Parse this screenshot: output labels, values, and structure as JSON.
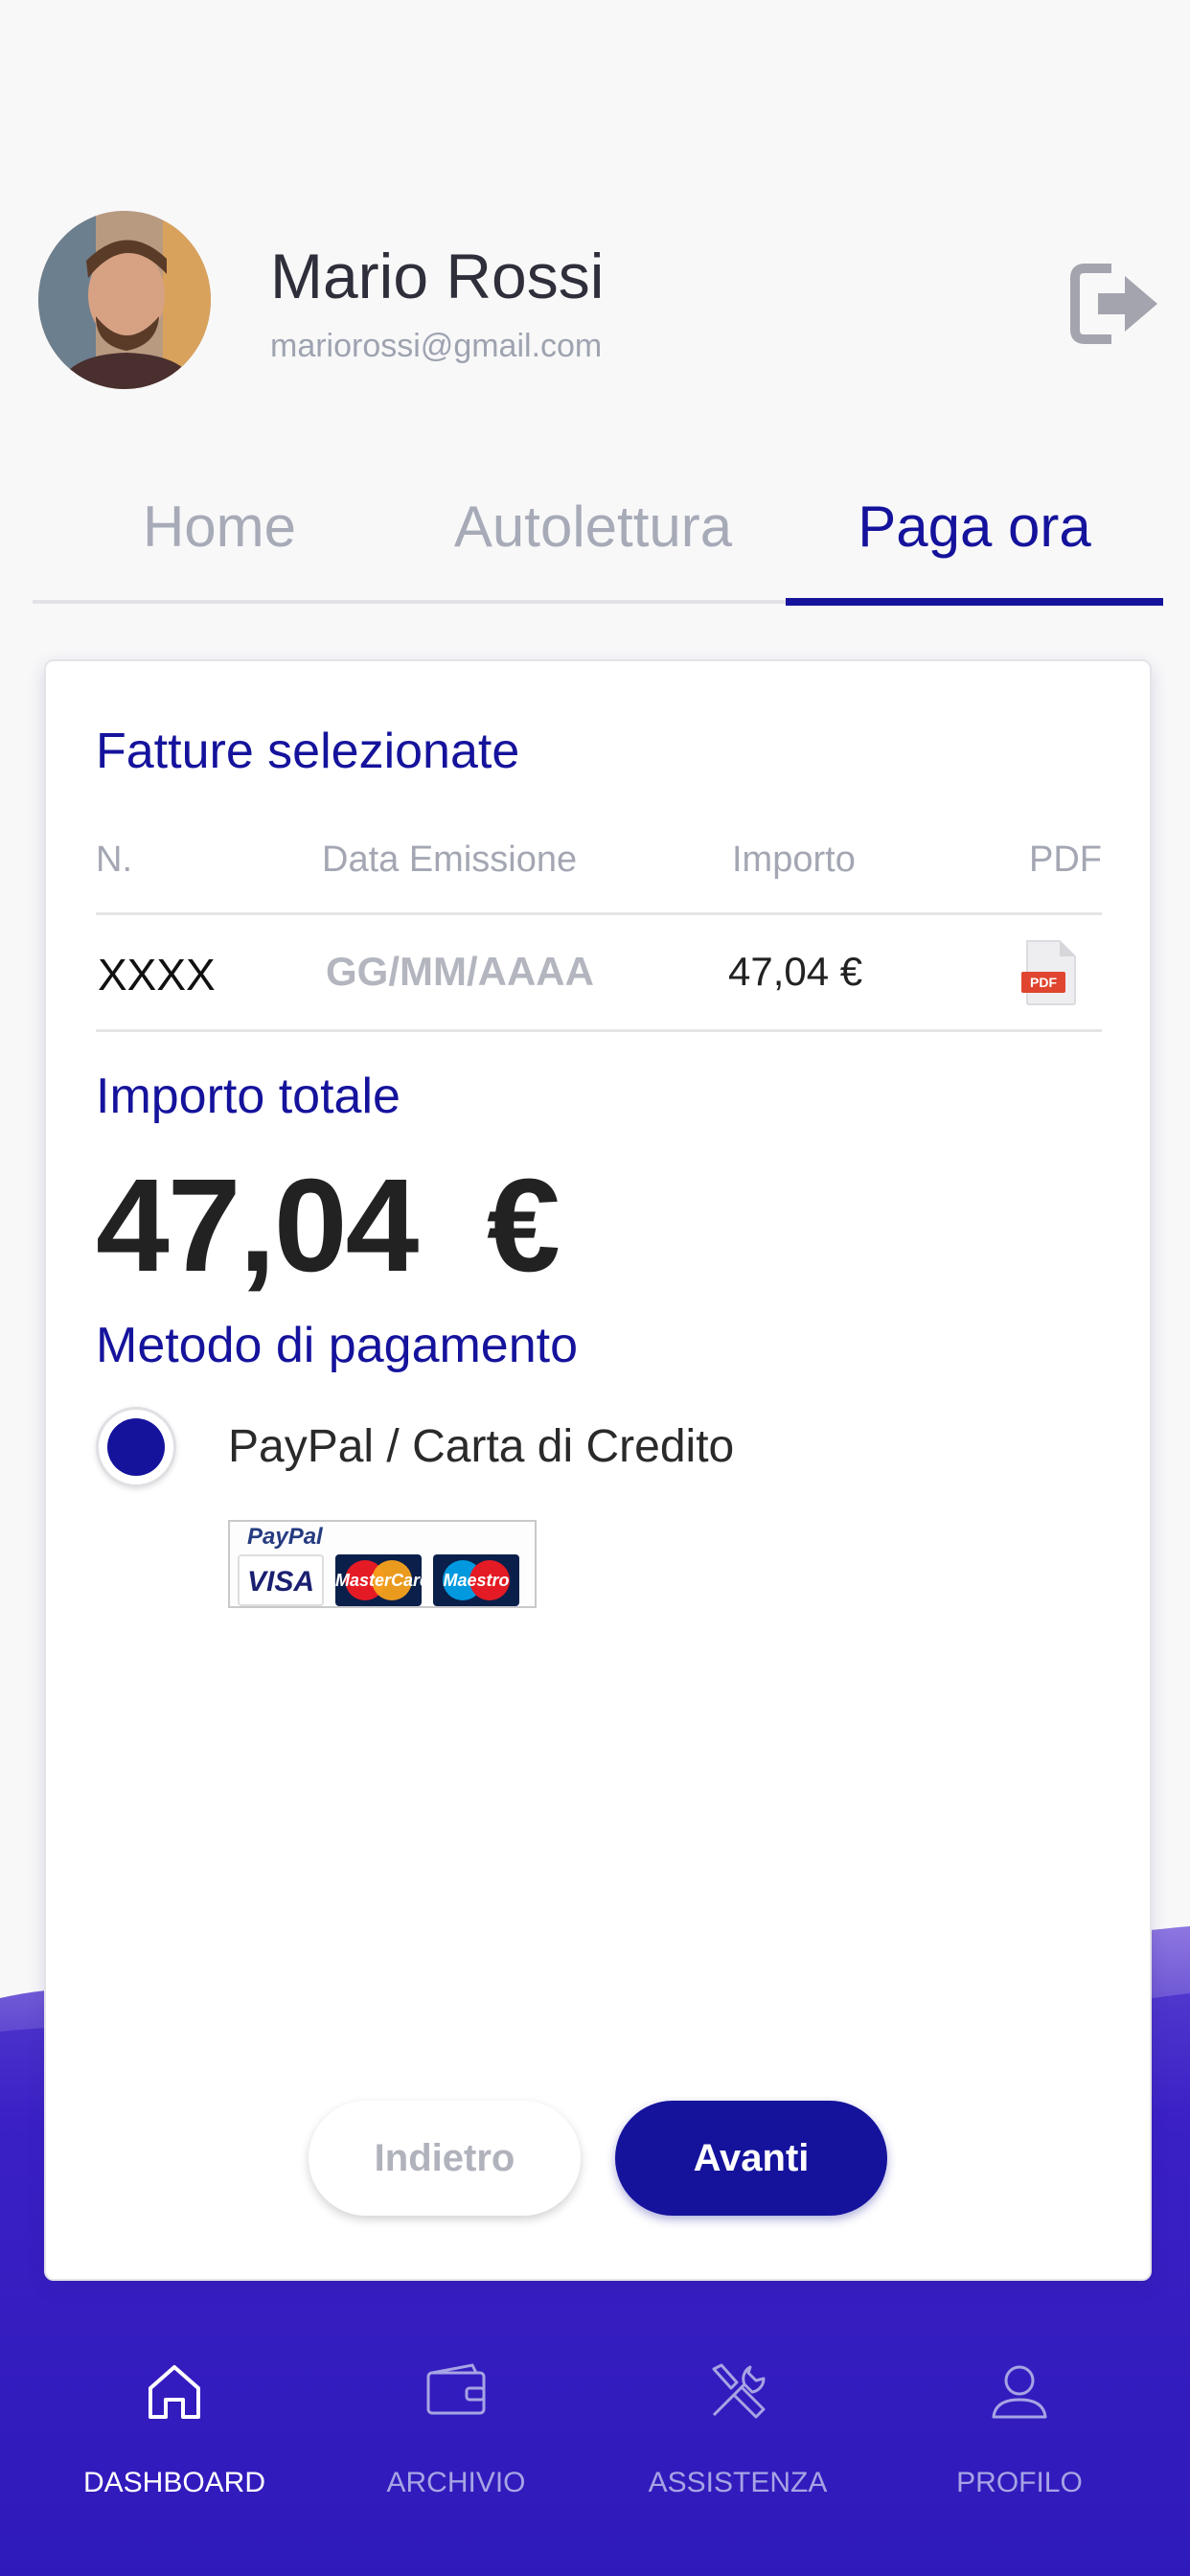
{
  "header": {
    "user_name": "Mario Rossi",
    "user_email": "mariorossi@gmail.com",
    "logout_icon": "logout-icon"
  },
  "tabs": [
    {
      "label": "Home",
      "active": false
    },
    {
      "label": "Autolettura",
      "active": false
    },
    {
      "label": "Paga ora",
      "active": true
    }
  ],
  "invoices": {
    "title": "Fatture selezionate",
    "columns": [
      "N.",
      "Data Emissione",
      "Importo",
      "PDF"
    ],
    "rows": [
      {
        "number": "XXXX",
        "date": "GG/MM/AAAA",
        "amount": "47,04 €",
        "pdf_icon": "pdf-icon"
      }
    ]
  },
  "total": {
    "title": "Importo totale",
    "value": "47,04  €"
  },
  "payment": {
    "title": "Metodo di pagamento",
    "option_label": "PayPal / Carta di Credito",
    "selected": true,
    "logos": {
      "paypal": "PayPal",
      "visa": "VISA",
      "mastercard": "MasterCard",
      "maestro": "Maestro"
    }
  },
  "actions": {
    "back_label": "Indietro",
    "next_label": "Avanti"
  },
  "bottom_nav": [
    {
      "label": "DASHBOARD",
      "icon": "home-icon",
      "active": true
    },
    {
      "label": "ARCHIVIO",
      "icon": "wallet-icon",
      "active": false
    },
    {
      "label": "ASSISTENZA",
      "icon": "tools-icon",
      "active": false
    },
    {
      "label": "PROFILO",
      "icon": "user-icon",
      "active": false
    }
  ],
  "colors": {
    "primary": "#15139c",
    "nav_gradient_start": "#3a22c4",
    "nav_gradient_end": "#2010a8",
    "inactive_tab": "#a7aab7"
  }
}
